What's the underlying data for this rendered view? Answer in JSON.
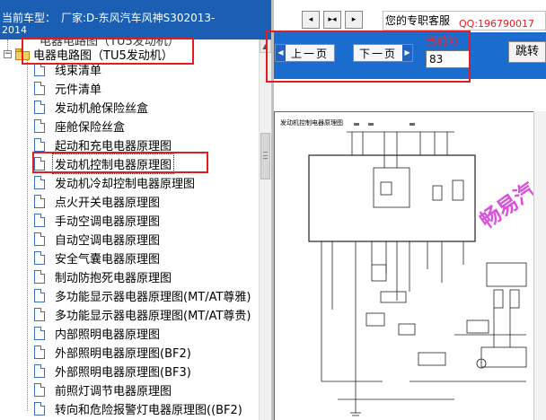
{
  "header": {
    "car_label": "当前车型：",
    "car_value": "厂家:D-东风汽车风神S302013-",
    "car_year": "2014"
  },
  "tree": {
    "ghost_label": "电器电路图（TU5发动机）",
    "root": {
      "label": "电器电路图（TU5发动机）",
      "expander": "−"
    },
    "items": [
      {
        "label": "线束清单"
      },
      {
        "label": "元件清单"
      },
      {
        "label": "发动机舱保险丝盒"
      },
      {
        "label": "座舱保险丝盒"
      },
      {
        "label": "起动和充电电器原理图"
      },
      {
        "label": "发动机控制电器原理图",
        "selected": true
      },
      {
        "label": "发动机冷却控制电器原理图"
      },
      {
        "label": "点火开关电器原理图"
      },
      {
        "label": "手动空调电器原理图"
      },
      {
        "label": "自动空调电器原理图"
      },
      {
        "label": "安全气囊电器原理图"
      },
      {
        "label": "制动防抱死电器原理图"
      },
      {
        "label": "多功能显示器电器原理图(MT/AT尊雅)"
      },
      {
        "label": "多功能显示器电器原理图(MT/AT尊贵)"
      },
      {
        "label": "内部照明电器原理图"
      },
      {
        "label": "外部照明电器原理图(BF2)"
      },
      {
        "label": "外部照明电器原理图(BF3)"
      },
      {
        "label": "前照灯调节电器原理图"
      },
      {
        "label": "转向和危险报警灯电器原理图((BF2)"
      }
    ]
  },
  "service": {
    "label": "您的专职客服",
    "qq": "QQ:196790017"
  },
  "nav": {
    "prev_label": "上一页",
    "next_label": "下一页",
    "current_label": "当前为",
    "current_page": "83",
    "jump_label": "跳转"
  },
  "sheet": {
    "title": "发动机控制电器原理图",
    "watermark": "畅易汽"
  },
  "colors": {
    "header_bg": "#1a5fb4",
    "nav_bg": "#1a6ccf",
    "callout": "#e31b23",
    "watermark": "#d43ad9"
  }
}
